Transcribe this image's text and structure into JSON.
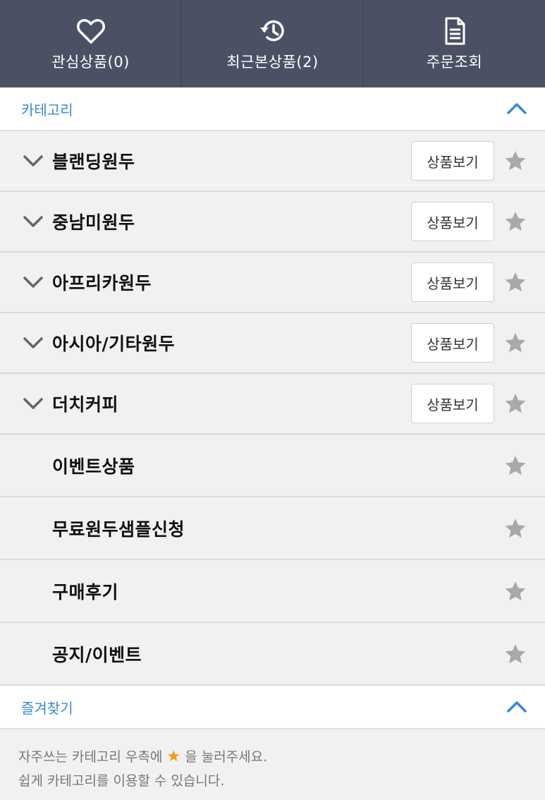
{
  "topbar": {
    "tabs": [
      {
        "label": "관심상품(0)",
        "icon": "heart-icon"
      },
      {
        "label": "최근본상품(2)",
        "icon": "history-icon"
      },
      {
        "label": "주문조회",
        "icon": "document-icon"
      }
    ]
  },
  "category": {
    "title": "카테고리",
    "view_label": "상품보기",
    "items": [
      {
        "label": "블랜딩원두",
        "expandable": true
      },
      {
        "label": "중남미원두",
        "expandable": true
      },
      {
        "label": "아프리카원두",
        "expandable": true
      },
      {
        "label": "아시아/기타원두",
        "expandable": true
      },
      {
        "label": "더치커피",
        "expandable": true
      },
      {
        "label": "이벤트상품",
        "expandable": false
      },
      {
        "label": "무료원두샘플신청",
        "expandable": false
      },
      {
        "label": "구매후기",
        "expandable": false
      },
      {
        "label": "공지/이벤트",
        "expandable": false
      }
    ]
  },
  "favorites": {
    "title": "즐겨찾기",
    "hint_part1": "자주쓰는 카테고리 우측에",
    "hint_star": "★",
    "hint_part2": "을 눌러주세요.",
    "hint_line2": "쉽게 카테고리를 이용할 수 있습니다."
  },
  "colors": {
    "topbar_bg": "#4b5165",
    "accent_blue": "#3a87d6",
    "star_gray": "#a9a9a9",
    "star_orange": "#f39c12"
  }
}
